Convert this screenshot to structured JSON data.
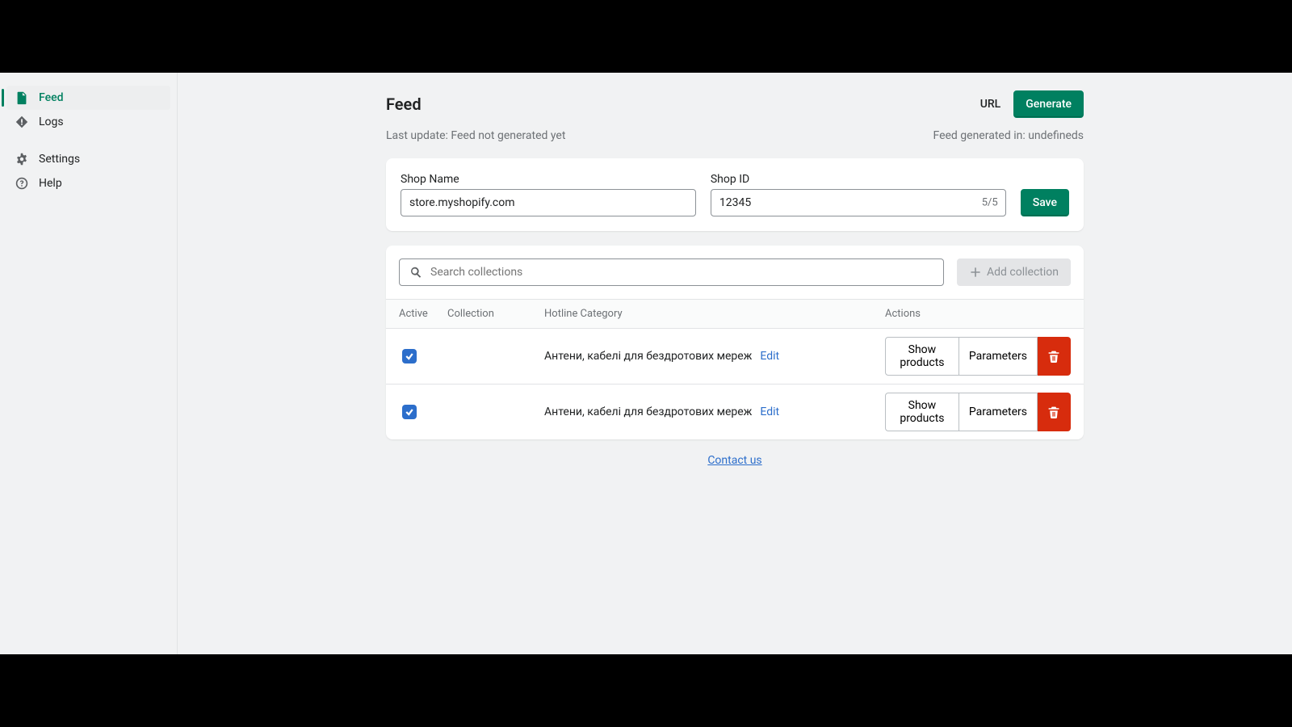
{
  "sidebar": {
    "groups": [
      {
        "items": [
          {
            "key": "feed",
            "label": "Feed",
            "icon": "file-icon",
            "active": true
          },
          {
            "key": "logs",
            "label": "Logs",
            "icon": "alert-icon",
            "active": false
          }
        ]
      },
      {
        "items": [
          {
            "key": "settings",
            "label": "Settings",
            "icon": "gear-icon",
            "active": false
          },
          {
            "key": "help",
            "label": "Help",
            "icon": "help-icon",
            "active": false
          }
        ]
      }
    ]
  },
  "header": {
    "title": "Feed",
    "url_label": "URL",
    "generate_label": "Generate"
  },
  "status": {
    "last_update": "Last update: Feed not generated yet",
    "generated_in": "Feed generated in: undefineds"
  },
  "form": {
    "shop_name_label": "Shop Name",
    "shop_name_value": "store.myshopify.com",
    "shop_id_label": "Shop ID",
    "shop_id_value": "12345",
    "shop_id_counter": "5/5",
    "save_label": "Save"
  },
  "collections": {
    "search_placeholder": "Search collections",
    "add_label": "Add collection",
    "columns": {
      "active": "Active",
      "collection": "Collection",
      "category": "Hotline Category",
      "actions": "Actions"
    },
    "edit_label": "Edit",
    "show_products_label": "Show products",
    "parameters_label": "Parameters",
    "rows": [
      {
        "active": true,
        "collection": "",
        "category": "Антени, кабелі для бездротових мереж"
      },
      {
        "active": true,
        "collection": "",
        "category": "Антени, кабелі для бездротових мереж"
      }
    ]
  },
  "footer": {
    "contact": "Contact us"
  }
}
